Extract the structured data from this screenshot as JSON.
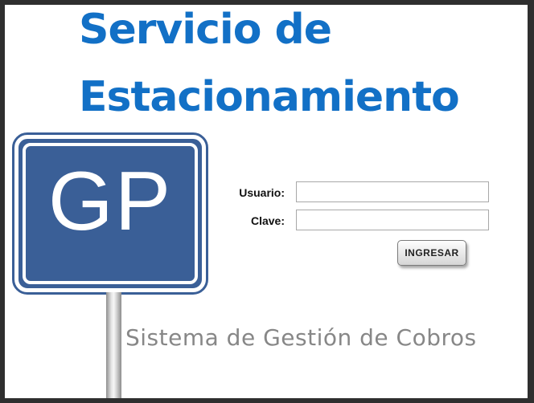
{
  "header": {
    "title_line1": "Servicio de",
    "title_line2": "Estacionamiento"
  },
  "logo": {
    "text": "GP",
    "icon": "parking-sign-icon"
  },
  "login": {
    "username_label": "Usuario:",
    "username_value": "",
    "password_label": "Clave:",
    "password_value": "",
    "submit_label": "INGRESAR"
  },
  "footer": {
    "subtitle": "Sistema de Gestión de Cobros"
  },
  "colors": {
    "title": "#1270c6",
    "sign": "#3a5f97",
    "subtitle": "#878787"
  }
}
